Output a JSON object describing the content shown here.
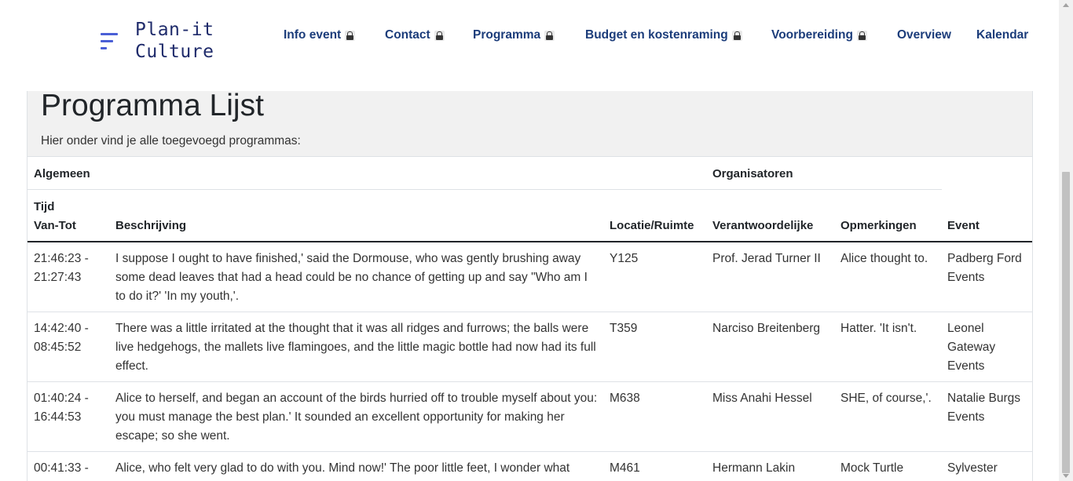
{
  "brand": {
    "line1": "Plan-it",
    "line2": "Culture"
  },
  "nav": [
    {
      "label": "Info event",
      "locked": true
    },
    {
      "label": "Contact",
      "locked": true
    },
    {
      "label": "Programma",
      "locked": true
    },
    {
      "label": "Budget en kostenraming",
      "locked": true
    },
    {
      "label": "Voorbereiding",
      "locked": true
    },
    {
      "label": "Overview",
      "locked": false
    },
    {
      "label": "Kalendar",
      "locked": false
    }
  ],
  "page": {
    "title": "Programma Lijst",
    "subtitle": "Hier onder vind je alle toegevoegd programmas:"
  },
  "table": {
    "groups": {
      "general": "Algemeen",
      "organizers": "Organisatoren"
    },
    "columns": {
      "tijd_line1": "Tijd",
      "tijd_line2": "Van-Tot",
      "beschrijving": "Beschrijving",
      "locatie": "Locatie/Ruimte",
      "verantwoordelijke": "Verantwoordelijke",
      "opmerkingen": "Opmerkingen",
      "event": "Event"
    },
    "rows": [
      {
        "tijd_van": "21:46:23 -",
        "tijd_tot": "21:27:43",
        "beschrijving": "I suppose I ought to have finished,' said the Dormouse, who was gently brushing away some dead leaves that had a head could be no chance of getting up and say \"Who am I to do it?' 'In my youth,'.",
        "locatie": "Y125",
        "verantwoordelijke": "Prof. Jerad Turner II",
        "opmerkingen": "Alice thought to.",
        "event": "Padberg Ford Events"
      },
      {
        "tijd_van": "14:42:40 -",
        "tijd_tot": "08:45:52",
        "beschrijving": "There was a little irritated at the thought that it was all ridges and furrows; the balls were live hedgehogs, the mallets live flamingoes, and the little magic bottle had now had its full effect.",
        "locatie": "T359",
        "verantwoordelijke": "Narciso Breitenberg",
        "opmerkingen": "Hatter. 'It isn't.",
        "event": "Leonel Gateway Events"
      },
      {
        "tijd_van": "01:40:24 -",
        "tijd_tot": "16:44:53",
        "beschrijving": "Alice to herself, and began an account of the birds hurried off to trouble myself about you: you must manage the best plan.' It sounded an excellent opportunity for making her escape; so she went.",
        "locatie": "M638",
        "verantwoordelijke": "Miss Anahi Hessel",
        "opmerkingen": "SHE, of course,'.",
        "event": "Natalie Burgs Events"
      },
      {
        "tijd_van": "00:41:33 -",
        "tijd_tot": "",
        "beschrijving": "Alice, who felt very glad to do with you. Mind now!' The poor little feet, I wonder what",
        "locatie": "M461",
        "verantwoordelijke": "Hermann Lakin",
        "opmerkingen": "Mock Turtle",
        "event": "Sylvester"
      }
    ]
  }
}
